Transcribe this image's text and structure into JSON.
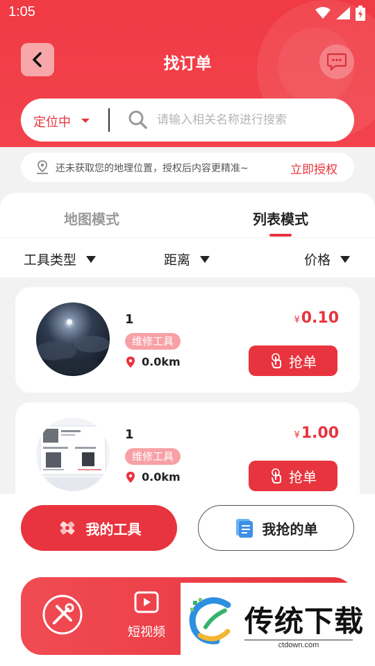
{
  "status_bar": {
    "time": "1:05",
    "icons": [
      "wifi-icon",
      "signal-icon",
      "battery-icon"
    ]
  },
  "header": {
    "title": "找订单",
    "back_icon": "chevron-left-icon",
    "message_icon": "chat-icon"
  },
  "search": {
    "location_label": "定位中",
    "placeholder": "请输入相关名称进行搜索"
  },
  "notice": {
    "text": "还未获取您的地理位置，授权后内容更精准~",
    "action": "立即授权"
  },
  "tabs": [
    {
      "label": "地图模式",
      "active": false
    },
    {
      "label": "列表模式",
      "active": true
    }
  ],
  "filters": [
    {
      "label": "工具类型"
    },
    {
      "label": "距离"
    },
    {
      "label": "价格"
    }
  ],
  "orders": [
    {
      "name": "1",
      "tag": "维修工具",
      "distance": "0.0km",
      "currency": "¥",
      "price": "0.10",
      "button": "抢单",
      "image": "night-sky-photo"
    },
    {
      "name": "1",
      "tag": "维修工具",
      "distance": "0.0km",
      "currency": "¥",
      "price": "1.00",
      "button": "抢单",
      "image": "tool-document-screenshot"
    }
  ],
  "actions": {
    "my_tools": "我的工具",
    "my_orders": "我抢的单"
  },
  "bottom_nav": {
    "video_label": "短视频"
  },
  "watermark": {
    "title": "传统下载",
    "url": "ctdown.com"
  },
  "colors": {
    "primary": "#e8343e",
    "tag": "#f7a1a6",
    "background": "#f2f2f2"
  }
}
